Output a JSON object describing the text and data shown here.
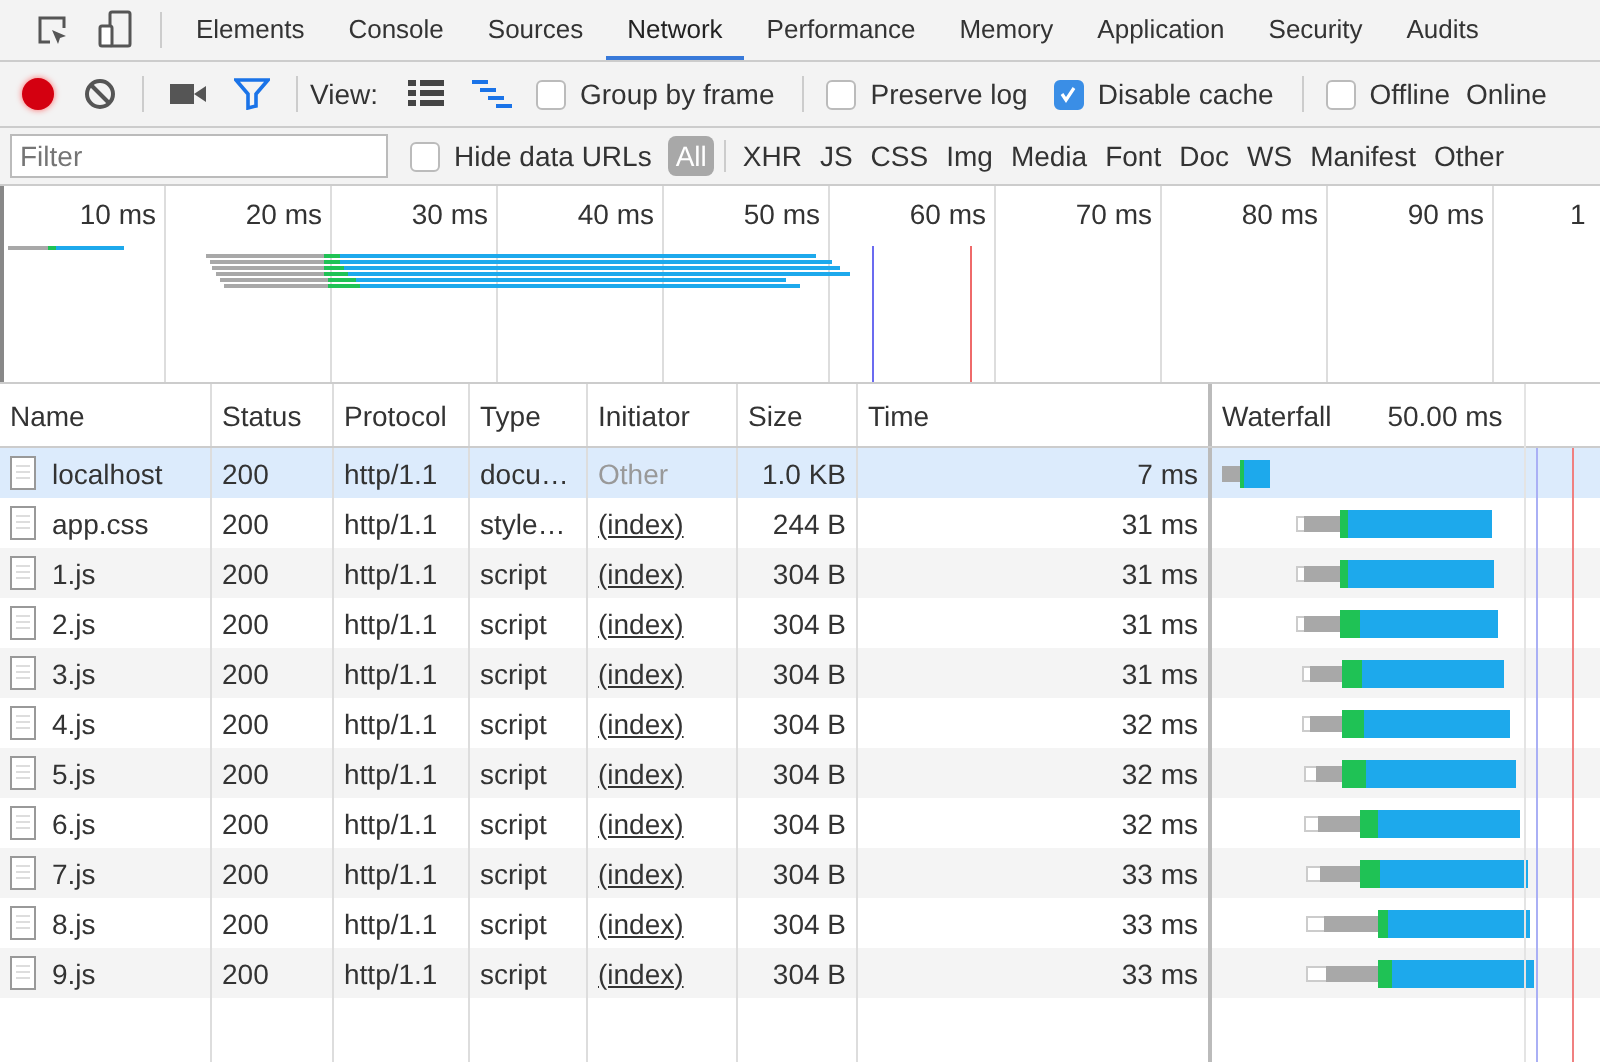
{
  "tabs": [
    {
      "label": "Elements",
      "selected": false
    },
    {
      "label": "Console",
      "selected": false
    },
    {
      "label": "Sources",
      "selected": false
    },
    {
      "label": "Network",
      "selected": true
    },
    {
      "label": "Performance",
      "selected": false
    },
    {
      "label": "Memory",
      "selected": false
    },
    {
      "label": "Application",
      "selected": false
    },
    {
      "label": "Security",
      "selected": false
    },
    {
      "label": "Audits",
      "selected": false
    }
  ],
  "toolbar": {
    "recording": true,
    "filter_active": true,
    "view_label": "View:",
    "view_options": [
      {
        "kind": "list",
        "selected": false
      },
      {
        "kind": "waterfall",
        "selected": true
      }
    ],
    "options": [
      {
        "label": "Group by frame",
        "checked": false
      },
      {
        "label": "Preserve log",
        "checked": false
      },
      {
        "label": "Disable cache",
        "checked": true
      },
      {
        "label": "Offline",
        "checked": false
      }
    ],
    "throttling": "Online"
  },
  "filter_bar": {
    "placeholder": "Filter",
    "hide_data_urls": {
      "label": "Hide data URLs",
      "checked": false
    },
    "types": [
      {
        "label": "All",
        "selected": true
      },
      {
        "label": "XHR",
        "selected": false
      },
      {
        "label": "JS",
        "selected": false
      },
      {
        "label": "CSS",
        "selected": false
      },
      {
        "label": "Img",
        "selected": false
      },
      {
        "label": "Media",
        "selected": false
      },
      {
        "label": "Font",
        "selected": false
      },
      {
        "label": "Doc",
        "selected": false
      },
      {
        "label": "WS",
        "selected": false
      },
      {
        "label": "Manifest",
        "selected": false
      },
      {
        "label": "Other",
        "selected": false
      }
    ]
  },
  "overview": {
    "ticks": [
      "10 ms",
      "20 ms",
      "30 ms",
      "40 ms",
      "50 ms",
      "60 ms",
      "70 ms",
      "80 ms",
      "90 ms",
      "1"
    ]
  },
  "table": {
    "columns": [
      "Name",
      "Status",
      "Protocol",
      "Type",
      "Initiator",
      "Size",
      "Time",
      "Waterfall"
    ],
    "waterfall_scale": "50.00 ms",
    "rows": [
      {
        "name": "localhost",
        "status": "200",
        "protocol": "http/1.1",
        "type": "docu…",
        "initiator": "Other",
        "initiator_link": false,
        "size": "1.0 KB",
        "time": "7 ms",
        "selected": true
      },
      {
        "name": "app.css",
        "status": "200",
        "protocol": "http/1.1",
        "type": "style…",
        "initiator": "(index)",
        "initiator_link": true,
        "size": "244 B",
        "time": "31 ms",
        "selected": false
      },
      {
        "name": "1.js",
        "status": "200",
        "protocol": "http/1.1",
        "type": "script",
        "initiator": "(index)",
        "initiator_link": true,
        "size": "304 B",
        "time": "31 ms",
        "selected": false
      },
      {
        "name": "2.js",
        "status": "200",
        "protocol": "http/1.1",
        "type": "script",
        "initiator": "(index)",
        "initiator_link": true,
        "size": "304 B",
        "time": "31 ms",
        "selected": false
      },
      {
        "name": "3.js",
        "status": "200",
        "protocol": "http/1.1",
        "type": "script",
        "initiator": "(index)",
        "initiator_link": true,
        "size": "304 B",
        "time": "31 ms",
        "selected": false
      },
      {
        "name": "4.js",
        "status": "200",
        "protocol": "http/1.1",
        "type": "script",
        "initiator": "(index)",
        "initiator_link": true,
        "size": "304 B",
        "time": "32 ms",
        "selected": false
      },
      {
        "name": "5.js",
        "status": "200",
        "protocol": "http/1.1",
        "type": "script",
        "initiator": "(index)",
        "initiator_link": true,
        "size": "304 B",
        "time": "32 ms",
        "selected": false
      },
      {
        "name": "6.js",
        "status": "200",
        "protocol": "http/1.1",
        "type": "script",
        "initiator": "(index)",
        "initiator_link": true,
        "size": "304 B",
        "time": "32 ms",
        "selected": false
      },
      {
        "name": "7.js",
        "status": "200",
        "protocol": "http/1.1",
        "type": "script",
        "initiator": "(index)",
        "initiator_link": true,
        "size": "304 B",
        "time": "33 ms",
        "selected": false
      },
      {
        "name": "8.js",
        "status": "200",
        "protocol": "http/1.1",
        "type": "script",
        "initiator": "(index)",
        "initiator_link": true,
        "size": "304 B",
        "time": "33 ms",
        "selected": false
      },
      {
        "name": "9.js",
        "status": "200",
        "protocol": "http/1.1",
        "type": "script",
        "initiator": "(index)",
        "initiator_link": true,
        "size": "304 B",
        "time": "33 ms",
        "selected": false
      }
    ]
  }
}
